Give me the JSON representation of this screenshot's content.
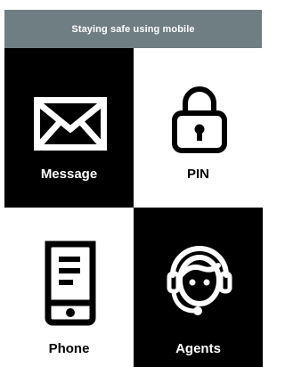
{
  "header": {
    "title": "Staying safe using mobile"
  },
  "tiles": [
    {
      "label": "Message",
      "icon": "envelope-icon",
      "theme": "dark"
    },
    {
      "label": "PIN",
      "icon": "padlock-icon",
      "theme": "light"
    },
    {
      "label": "Phone",
      "icon": "mobile-phone-icon",
      "theme": "light"
    },
    {
      "label": "Agents",
      "icon": "support-agent-headset-icon",
      "theme": "dark"
    }
  ],
  "colors": {
    "header_bg": "#6f7e83",
    "dark": "#000000",
    "light": "#ffffff"
  }
}
